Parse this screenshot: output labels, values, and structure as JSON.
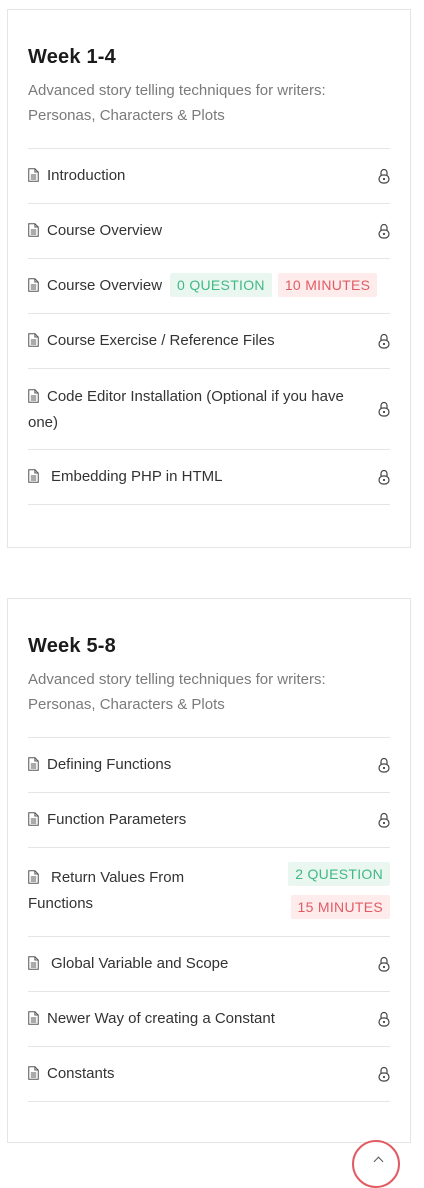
{
  "weeks": [
    {
      "title": "Week 1-4",
      "description": "Advanced story telling techniques for writers: Personas, Characters & Plots",
      "lessons": [
        {
          "label": "Introduction",
          "icon": "lock-icon"
        },
        {
          "label": "Course Overview",
          "icon": "lock-icon"
        },
        {
          "label": "Course Overview",
          "questions": "0 QUESTION",
          "duration": "10 MINUTES"
        },
        {
          "label": "Course Exercise / Reference Files",
          "icon": "lock-icon"
        },
        {
          "label": "Code Editor Installation (Optional if you have one)",
          "icon": "lock-icon"
        },
        {
          "label": "Embedding PHP in HTML",
          "icon": "lock-icon"
        }
      ]
    },
    {
      "title": "Week 5-8",
      "description": "Advanced story telling techniques for writers: Personas, Characters & Plots",
      "lessons": [
        {
          "label": "Defining Functions",
          "icon": "lock-icon"
        },
        {
          "label": "Function Parameters",
          "icon": "lock-icon"
        },
        {
          "label": "Return Values From Functions",
          "questions": "2 QUESTION",
          "duration": "15 MINUTES"
        },
        {
          "label": "Global Variable and Scope",
          "icon": "lock-icon"
        },
        {
          "label": "Newer Way of creating a Constant",
          "icon": "lock-icon"
        },
        {
          "label": "Constants",
          "icon": "lock-icon"
        }
      ]
    }
  ],
  "colors": {
    "accent_green": "#41b883",
    "accent_red": "#e15b64",
    "border": "#e5e5e5"
  }
}
